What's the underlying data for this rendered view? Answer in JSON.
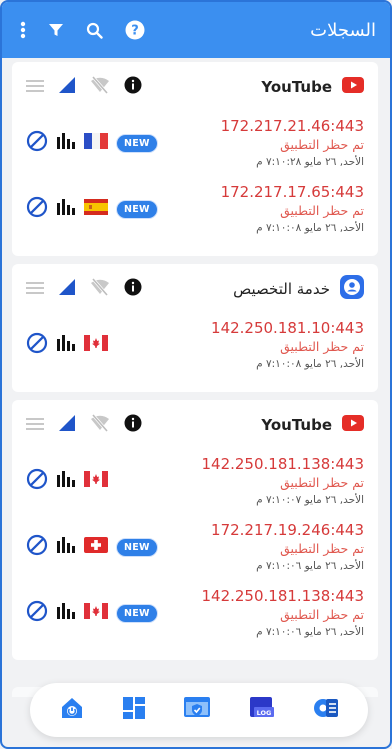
{
  "appbar": {
    "title": "السجلات",
    "icons": [
      "more-vertical-icon",
      "filter-icon",
      "search-icon",
      "help-icon"
    ]
  },
  "cards": [
    {
      "app_name": "YouTube",
      "app_icon": "youtube-icon",
      "connections": [
        {
          "ip": "172.217.21.46:443",
          "status": "تم حظر التطبيق",
          "time": "الأحد, ٢٦ مايو ٧:١٠:٢٨ م",
          "flag": "France",
          "is_new": true,
          "new_label": "NEW"
        },
        {
          "ip": "172.217.17.65:443",
          "status": "تم حظر التطبيق",
          "time": "الأحد, ٢٦ مايو ٧:١٠:٠٨ م",
          "flag": "Spain",
          "is_new": true,
          "new_label": "NEW"
        }
      ]
    },
    {
      "app_name": "خدمة التخصيص",
      "app_icon": "account-icon",
      "connections": [
        {
          "ip": "142.250.181.10:443",
          "status": "تم حظر التطبيق",
          "time": "الأحد, ٢٦ مايو ٧:١٠:٠٨ م",
          "flag": "Canada",
          "is_new": false,
          "new_label": ""
        }
      ]
    },
    {
      "app_name": "YouTube",
      "app_icon": "youtube-icon",
      "connections": [
        {
          "ip": "142.250.181.138:443",
          "status": "تم حظر التطبيق",
          "time": "الأحد, ٢٦ مايو ٧:١٠:٠٧ م",
          "flag": "Canada",
          "is_new": false,
          "new_label": ""
        },
        {
          "ip": "172.217.19.246:443",
          "status": "تم حظر التطبيق",
          "time": "الأحد, ٢٦ مايو ٧:١٠:٠٦ م",
          "flag": "Switzerland",
          "is_new": true,
          "new_label": "NEW"
        },
        {
          "ip": "142.250.181.138:443",
          "status": "تم حظر التطبيق",
          "time": "الأحد, ٢٦ مايو ٧:١٠:٠٦ م",
          "flag": "Canada",
          "is_new": true,
          "new_label": "NEW"
        }
      ]
    }
  ],
  "bottom_nav": [
    "home-icon",
    "dashboard-icon",
    "firewall-icon",
    "log-icon",
    "settings-list-icon"
  ],
  "colors": {
    "appbar": "#3b8ff0",
    "ip": "#d63a3a",
    "status": "#e0584f",
    "new_badge": "#2f80e8",
    "signal": "#1f55c9"
  }
}
